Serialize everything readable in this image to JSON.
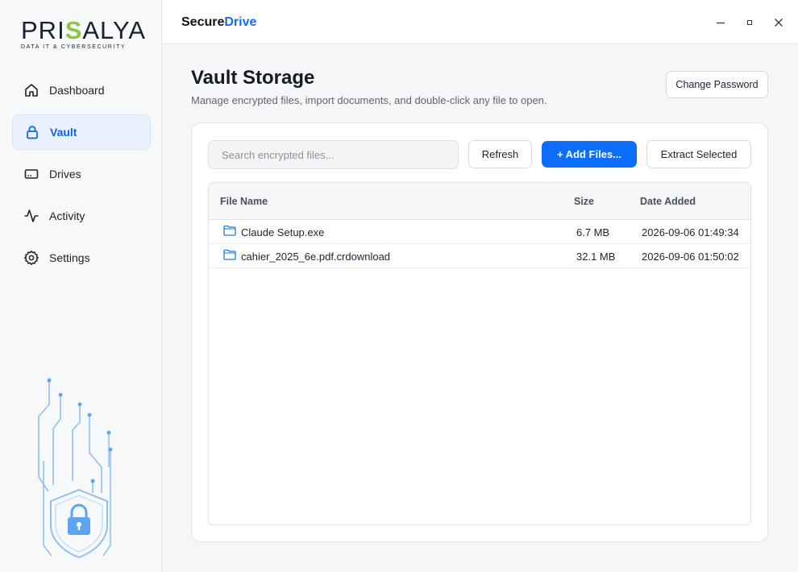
{
  "brand": {
    "logo_main_1": "PRI",
    "logo_main_accent": "S",
    "logo_main_2": "ALYA",
    "logo_sub": "DATA IT & CYBERSECURITY"
  },
  "sidebar": {
    "items": [
      {
        "label": "Dashboard",
        "icon": "home-icon"
      },
      {
        "label": "Vault",
        "icon": "lock-icon",
        "active": true
      },
      {
        "label": "Drives",
        "icon": "drive-icon"
      },
      {
        "label": "Activity",
        "icon": "activity-icon"
      },
      {
        "label": "Settings",
        "icon": "gear-icon"
      }
    ]
  },
  "titlebar": {
    "title_part1": "Secure",
    "title_part2": "Drive",
    "minimize": "—",
    "maximize": "▫",
    "close": "✕"
  },
  "page": {
    "title": "Vault Storage",
    "subtitle": "Manage encrypted files, import documents, and double-click any file to open.",
    "change_password": "Change Password"
  },
  "toolbar": {
    "search_placeholder": "Search encrypted files...",
    "refresh": "Refresh",
    "add_files": "+ Add Files...",
    "extract": "Extract Selected"
  },
  "table": {
    "headers": {
      "name": "File Name",
      "size": "Size",
      "date": "Date Added"
    },
    "rows": [
      {
        "name": "Claude Setup.exe",
        "size": "6.7 MB",
        "date": "2026-09-06 01:49:34"
      },
      {
        "name": "cahier_2025_6e.pdf.crdownload",
        "size": "32.1 MB",
        "date": "2026-09-06 01:50:02"
      }
    ]
  },
  "colors": {
    "accent": "#0d6efd",
    "brand_green": "#8cc63f",
    "active_bg": "#e9f1fc"
  }
}
